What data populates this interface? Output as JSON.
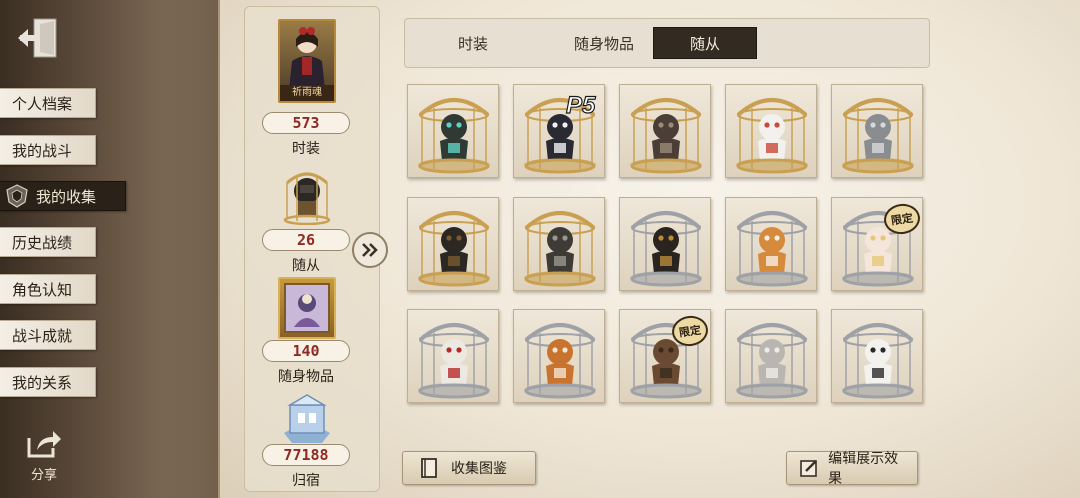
{
  "nav": {
    "items": [
      {
        "label": "个人档案",
        "active": false
      },
      {
        "label": "我的战斗",
        "active": false
      },
      {
        "label": "我的收集",
        "active": true
      },
      {
        "label": "历史战绩",
        "active": false
      },
      {
        "label": "角色认知",
        "active": false
      },
      {
        "label": "战斗成就",
        "active": false
      },
      {
        "label": "我的关系",
        "active": false
      }
    ],
    "share_label": "分享"
  },
  "summary": {
    "costume": {
      "portrait_name": "祈雨魂",
      "count": "573",
      "label": "时装"
    },
    "pet": {
      "count": "26",
      "label": "随从"
    },
    "accessory": {
      "count": "140",
      "label": "随身物品"
    },
    "home": {
      "count": "77188",
      "label": "归宿"
    }
  },
  "tabs": [
    {
      "label": "时装",
      "active": false
    },
    {
      "label": "随身物品",
      "active": false
    },
    {
      "label": "随从",
      "active": true
    }
  ],
  "grid": {
    "limited_label": "限定",
    "p5_logo_text": "P5",
    "items": [
      {
        "cage": "gold",
        "creature": "antlered-figure",
        "limited": false,
        "p5": false
      },
      {
        "cage": "gold",
        "creature": "morgana-cat",
        "limited": false,
        "p5": true
      },
      {
        "cage": "gold",
        "creature": "hooded-owl",
        "limited": false,
        "p5": false
      },
      {
        "cage": "gold",
        "creature": "white-fox",
        "limited": false,
        "p5": false
      },
      {
        "cage": "gold",
        "creature": "mirror-egg",
        "limited": false,
        "p5": false
      },
      {
        "cage": "gold",
        "creature": "masked-doll",
        "limited": false,
        "p5": false
      },
      {
        "cage": "gold",
        "creature": "robot-cart",
        "limited": false,
        "p5": false
      },
      {
        "cage": "silver",
        "creature": "black-bird",
        "limited": false,
        "p5": false
      },
      {
        "cage": "silver",
        "creature": "shiba-dog",
        "limited": false,
        "p5": false
      },
      {
        "cage": "silver",
        "creature": "angel-doll",
        "limited": true,
        "p5": false
      },
      {
        "cage": "silver",
        "creature": "red-cape-bear",
        "limited": false,
        "p5": false
      },
      {
        "cage": "silver",
        "creature": "fox-cub",
        "limited": false,
        "p5": false
      },
      {
        "cage": "silver",
        "creature": "stitched-bear",
        "limited": true,
        "p5": false
      },
      {
        "cage": "silver",
        "creature": "baby-elephant",
        "limited": false,
        "p5": false
      },
      {
        "cage": "silver",
        "creature": "white-rabbit",
        "limited": false,
        "p5": false
      }
    ]
  },
  "buttons": {
    "catalog_label": "收集图鉴",
    "edit_label": "编辑展示效果"
  },
  "colors": {
    "count_text": "#8e2a23",
    "active_tab_bg": "#332a21",
    "gold_cage": "#c9a052",
    "silver_cage": "#9ea1a6"
  }
}
